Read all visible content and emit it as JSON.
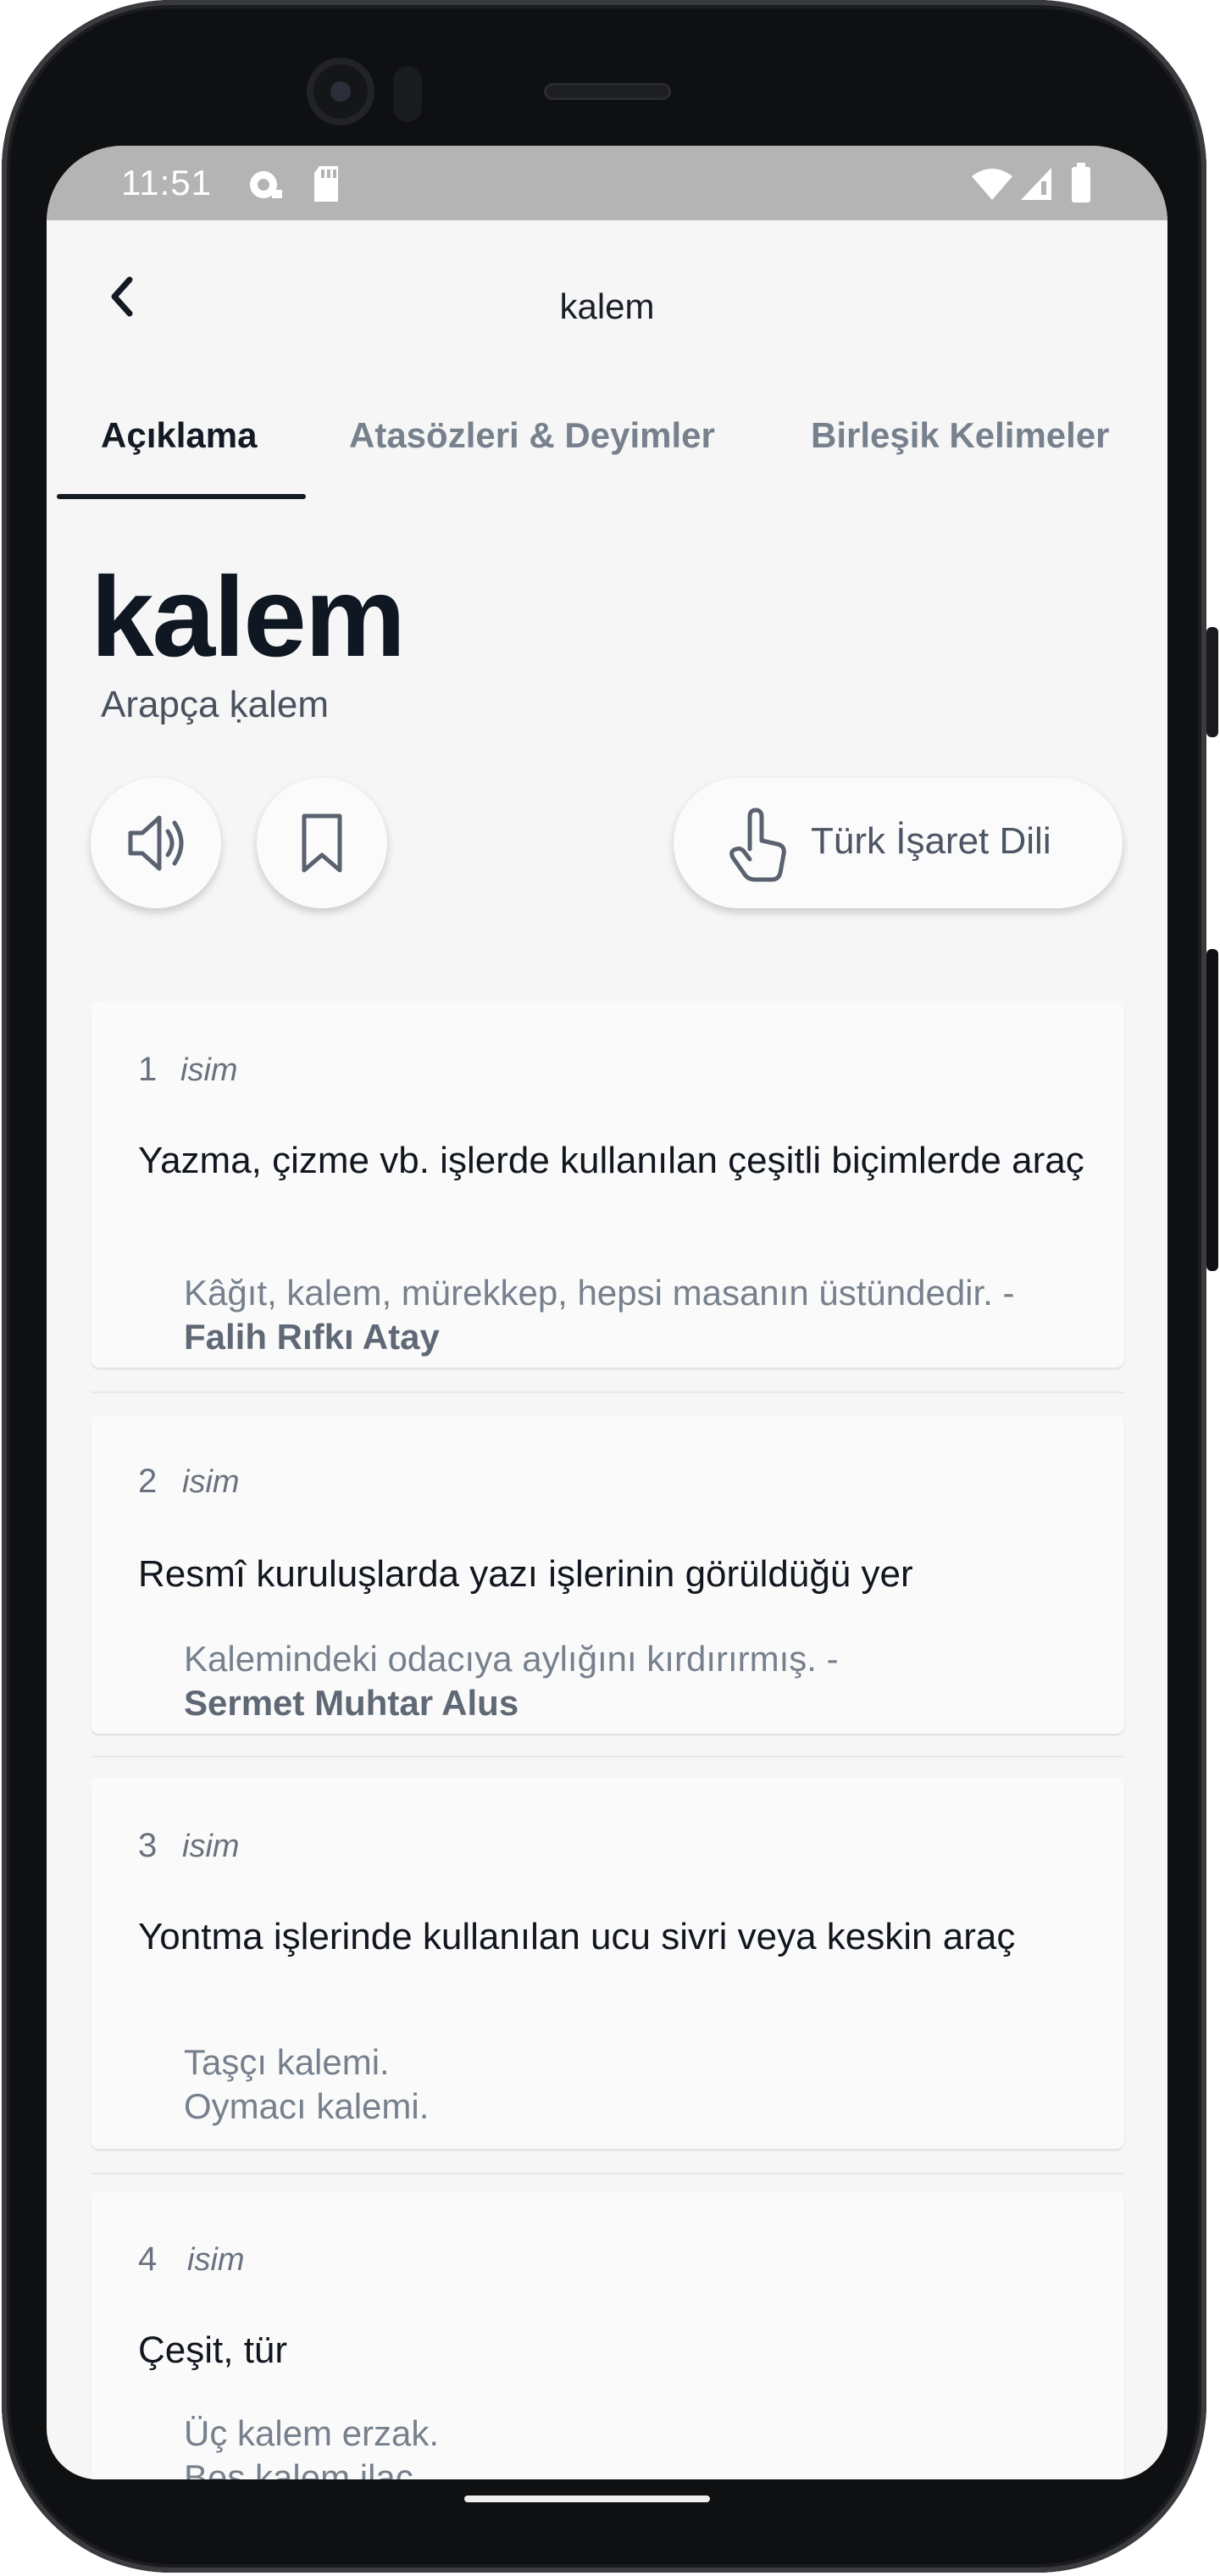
{
  "status_bar": {
    "time": "11:51"
  },
  "app_bar": {
    "title": "kalem"
  },
  "tabs": [
    {
      "label": "Açıklama",
      "active": true
    },
    {
      "label": "Atasözleri & Deyimler",
      "active": false
    },
    {
      "label": "Birleşik Kelimeler",
      "active": false
    }
  ],
  "entry": {
    "word": "kalem",
    "origin": "Arapça ḳalem"
  },
  "actions": {
    "sign_language_label": "Türk İşaret Dili"
  },
  "meanings": [
    {
      "number": "1",
      "pos": "isim",
      "definition": "Yazma, çizme vb. işlerde kullanılan çeşitli biçimlerde araç",
      "example": "Kâğıt, kalem, mürekkep, hepsi masanın üstündedir. -",
      "author": "Falih Rıfkı Atay"
    },
    {
      "number": "2",
      "pos": "isim",
      "definition": "Resmî kuruluşlarda yazı işlerinin görüldüğü yer",
      "example": "Kalemindeki odacıya aylığını kırdırırmış. -",
      "author": "Sermet Muhtar Alus"
    },
    {
      "number": "3",
      "pos": "isim",
      "definition": "Yontma işlerinde kullanılan ucu sivri veya keskin araç",
      "example_lines": [
        "Taşçı kalemi.",
        "Oymacı kalemi."
      ]
    },
    {
      "number": "4",
      "pos": "isim",
      "definition": "Çeşit, tür",
      "example_lines": [
        "Üç kalem erzak.",
        "Beş kalem ilaç."
      ]
    }
  ]
}
